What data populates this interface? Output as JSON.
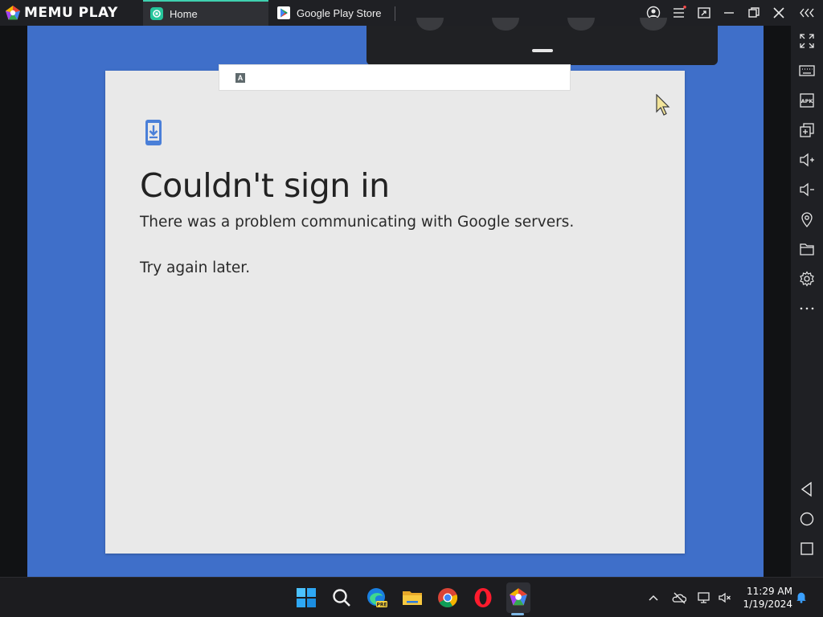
{
  "app": {
    "brand": "MEMU PLAY",
    "tabs": [
      {
        "label": "Home",
        "active": true
      },
      {
        "label": "Google Play Store",
        "active": false
      }
    ]
  },
  "dialog": {
    "title": "Couldn't sign in",
    "message": "There was a problem communicating with Google servers.",
    "hint": "Try again later."
  },
  "taskbar": {
    "time": "11:29 AM",
    "date": "1/19/2024"
  },
  "colors": {
    "viewport_bg": "#3f6fc9",
    "card_bg": "#e9e9e9",
    "accent_tab": "#3fd0b0"
  }
}
